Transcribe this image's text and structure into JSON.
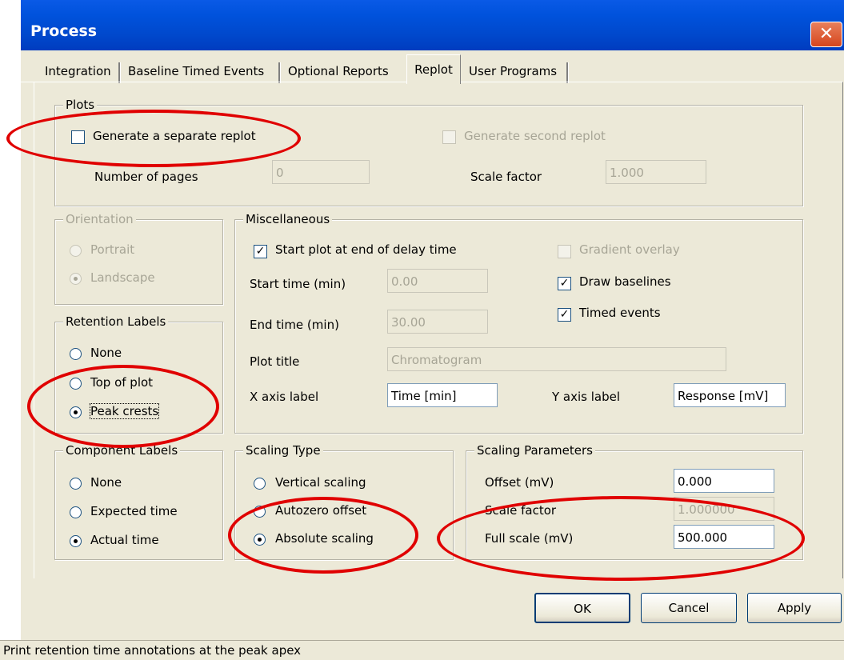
{
  "window": {
    "title": "Process",
    "close_glyph": "✕"
  },
  "tabs": [
    "Integration",
    "Baseline Timed Events",
    "Optional Reports",
    "Replot",
    "User Programs"
  ],
  "active_tab": "Replot",
  "plots": {
    "legend": "Plots",
    "separate_replot": {
      "label": "Generate a separate replot",
      "checked": false
    },
    "second_replot": {
      "label": "Generate second replot",
      "checked": false,
      "enabled": false
    },
    "pages_label": "Number of pages",
    "pages_value": "0",
    "scale_label": "Scale factor",
    "scale_value": "1.000"
  },
  "orientation": {
    "legend": "Orientation",
    "portrait": "Portrait",
    "landscape": "Landscape",
    "selected": "Landscape"
  },
  "retention": {
    "legend": "Retention Labels",
    "none": "None",
    "top": "Top of plot",
    "peak": "Peak crests",
    "selected": "Peak crests"
  },
  "component": {
    "legend": "Component Labels",
    "none": "None",
    "expected": "Expected time",
    "actual": "Actual time",
    "selected": "Actual time"
  },
  "misc": {
    "legend": "Miscellaneous",
    "start_at_delay": {
      "label": "Start plot at end of delay time",
      "checked": true
    },
    "start_time_label": "Start time (min)",
    "start_time_value": "0.00",
    "end_time_label": "End time (min)",
    "end_time_value": "30.00",
    "gradient_overlay": {
      "label": "Gradient overlay",
      "checked": false,
      "enabled": false
    },
    "draw_baselines": {
      "label": "Draw baselines",
      "checked": true
    },
    "timed_events": {
      "label": "Timed events",
      "checked": true
    },
    "plot_title_label": "Plot title",
    "plot_title_value": "Chromatogram",
    "x_label": "X axis label",
    "x_value": "Time [min]",
    "y_label": "Y axis label",
    "y_value": "Response [mV]"
  },
  "scaling_type": {
    "legend": "Scaling Type",
    "vertical": "Vertical scaling",
    "autozero": "Autozero offset",
    "absolute": "Absolute scaling",
    "selected": "Absolute scaling"
  },
  "scaling_params": {
    "legend": "Scaling Parameters",
    "offset_label": "Offset (mV)",
    "offset_value": "0.000",
    "scale_label": "Scale factor",
    "scale_value": "1.000000",
    "full_label": "Full scale (mV)",
    "full_value": "500.000"
  },
  "buttons": {
    "ok": "OK",
    "cancel": "Cancel",
    "apply": "Apply"
  },
  "status": "Print retention time annotations at the peak apex",
  "check_glyph": "✓",
  "annotation_color": "#e00000"
}
